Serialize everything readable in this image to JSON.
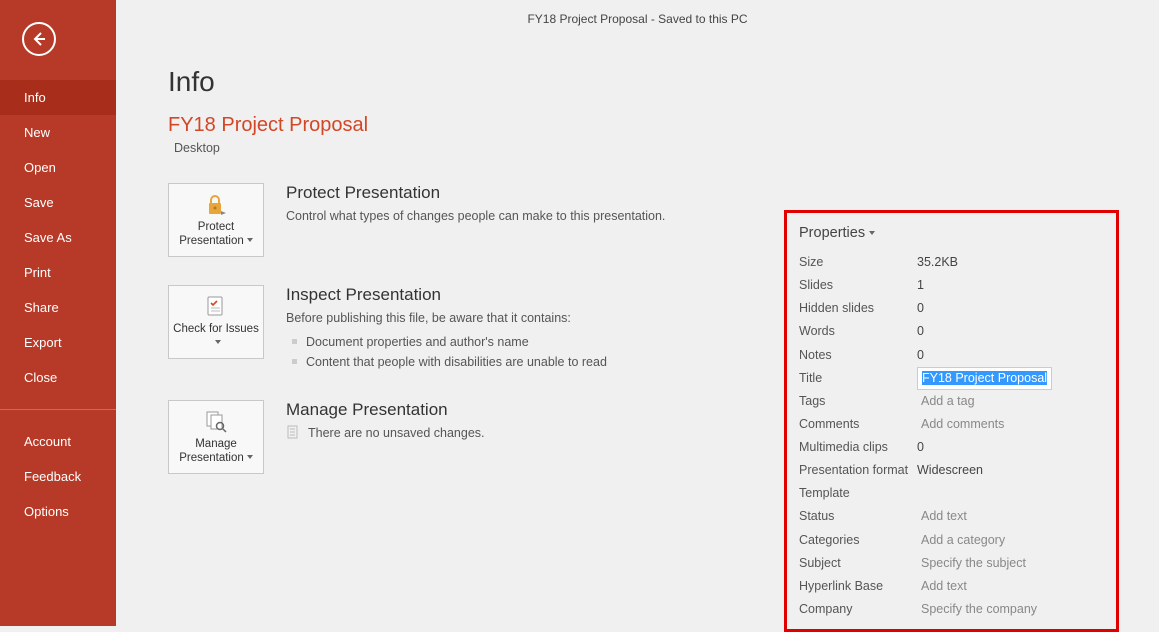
{
  "titleBar": {
    "docName": "FY18 Project Proposal",
    "sep": "  -  ",
    "status": "Saved to this PC"
  },
  "backIcon": "back",
  "nav": {
    "items": [
      {
        "label": "Info",
        "selected": true
      },
      {
        "label": "New"
      },
      {
        "label": "Open"
      },
      {
        "label": "Save"
      },
      {
        "label": "Save As"
      },
      {
        "label": "Print"
      },
      {
        "label": "Share"
      },
      {
        "label": "Export"
      },
      {
        "label": "Close"
      }
    ],
    "footer": [
      {
        "label": "Account"
      },
      {
        "label": "Feedback"
      },
      {
        "label": "Options"
      }
    ]
  },
  "page": {
    "heading": "Info",
    "docTitle": "FY18 Project Proposal",
    "docLocation": "Desktop"
  },
  "sections": {
    "protect": {
      "btnLabel": "Protect Presentation",
      "heading": "Protect Presentation",
      "desc": "Control what types of changes people can make to this presentation."
    },
    "inspect": {
      "btnLabel": "Check for Issues",
      "heading": "Inspect Presentation",
      "desc": "Before publishing this file, be aware that it contains:",
      "items": [
        "Document properties and author's name",
        "Content that people with disabilities are unable to read"
      ]
    },
    "manage": {
      "btnLabel": "Manage Presentation",
      "heading": "Manage Presentation",
      "desc": "There are no unsaved changes."
    }
  },
  "properties": {
    "title": "Properties",
    "rows": [
      {
        "label": "Size",
        "value": "35.2KB",
        "type": "text"
      },
      {
        "label": "Slides",
        "value": "1",
        "type": "text"
      },
      {
        "label": "Hidden slides",
        "value": "0",
        "type": "text"
      },
      {
        "label": "Words",
        "value": "0",
        "type": "text"
      },
      {
        "label": "Notes",
        "value": "0",
        "type": "text"
      },
      {
        "label": "Title",
        "value": "FY18 Project Proposal",
        "type": "input-active"
      },
      {
        "label": "Tags",
        "value": "Add a tag",
        "type": "placeholder"
      },
      {
        "label": "Comments",
        "value": "Add comments",
        "type": "placeholder"
      },
      {
        "label": "Multimedia clips",
        "value": "0",
        "type": "text"
      },
      {
        "label": "Presentation format",
        "value": "Widescreen",
        "type": "text"
      },
      {
        "label": "Template",
        "value": "",
        "type": "text"
      },
      {
        "label": "Status",
        "value": "Add text",
        "type": "placeholder"
      },
      {
        "label": "Categories",
        "value": "Add a category",
        "type": "placeholder"
      },
      {
        "label": "Subject",
        "value": "Specify the subject",
        "type": "placeholder"
      },
      {
        "label": "Hyperlink Base",
        "value": "Add text",
        "type": "placeholder"
      },
      {
        "label": "Company",
        "value": "Specify the company",
        "type": "placeholder"
      }
    ]
  }
}
